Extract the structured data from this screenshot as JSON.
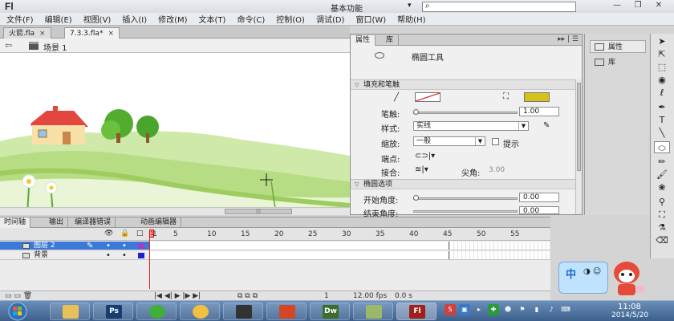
{
  "app": {
    "logo": "Fl",
    "workspace": "基本功能",
    "search_placeholder": ""
  },
  "menu": [
    "文件(F)",
    "编辑(E)",
    "视图(V)",
    "插入(I)",
    "修改(M)",
    "文本(T)",
    "命令(C)",
    "控制(O)",
    "调试(D)",
    "窗口(W)",
    "帮助(H)"
  ],
  "tabs": [
    {
      "label": "火箭.fla",
      "close": "×"
    },
    {
      "label": "7.3.3.fla*",
      "close": "×"
    }
  ],
  "scene": {
    "label": "场景 1"
  },
  "properties": {
    "tabs": [
      "属性",
      "库"
    ],
    "tool_name": "椭圆工具",
    "fill_stroke_section": "填充和笔触",
    "stroke_label": "笔触:",
    "stroke_value": "1.00",
    "style_label": "样式:",
    "style_value": "实线",
    "scale_label": "缩放:",
    "scale_value": "一般",
    "hint_label": "提示",
    "cap_label": "端点:",
    "join_label": "接合:",
    "miter_label": "尖角:",
    "miter_value": "3.00",
    "oval_section": "椭圆选项",
    "start_angle_label": "开始角度:",
    "start_angle_value": "0.00",
    "end_angle_label": "结束角度:",
    "end_angle_value": "0.00",
    "stroke_color": "#ffffff",
    "fill_color": "#d4c21a"
  },
  "side_panel": {
    "items": [
      "属性",
      "库"
    ]
  },
  "timeline": {
    "tabs": [
      "时间轴",
      "输出",
      "编译器错误",
      "动画编辑器"
    ],
    "frame_numbers": [
      "1",
      "5",
      "10",
      "15",
      "20",
      "25",
      "30",
      "35",
      "40",
      "45",
      "50",
      "55"
    ],
    "layers": [
      {
        "name": "图层 2",
        "selected": true,
        "color": "#a040c0"
      },
      {
        "name": "背景",
        "selected": false,
        "color": "#2020d0"
      }
    ],
    "current_frame": "1",
    "fps": "12.00 fps",
    "time": "0.0 s"
  },
  "taskbar": {
    "apps": [
      "explorer",
      "Ps",
      "browser",
      "qq",
      "video",
      "ppt",
      "Dw",
      "flash-cs",
      "Fl"
    ],
    "time": "11:08",
    "date": "2014/5/20"
  },
  "ime": {
    "label": "中"
  }
}
